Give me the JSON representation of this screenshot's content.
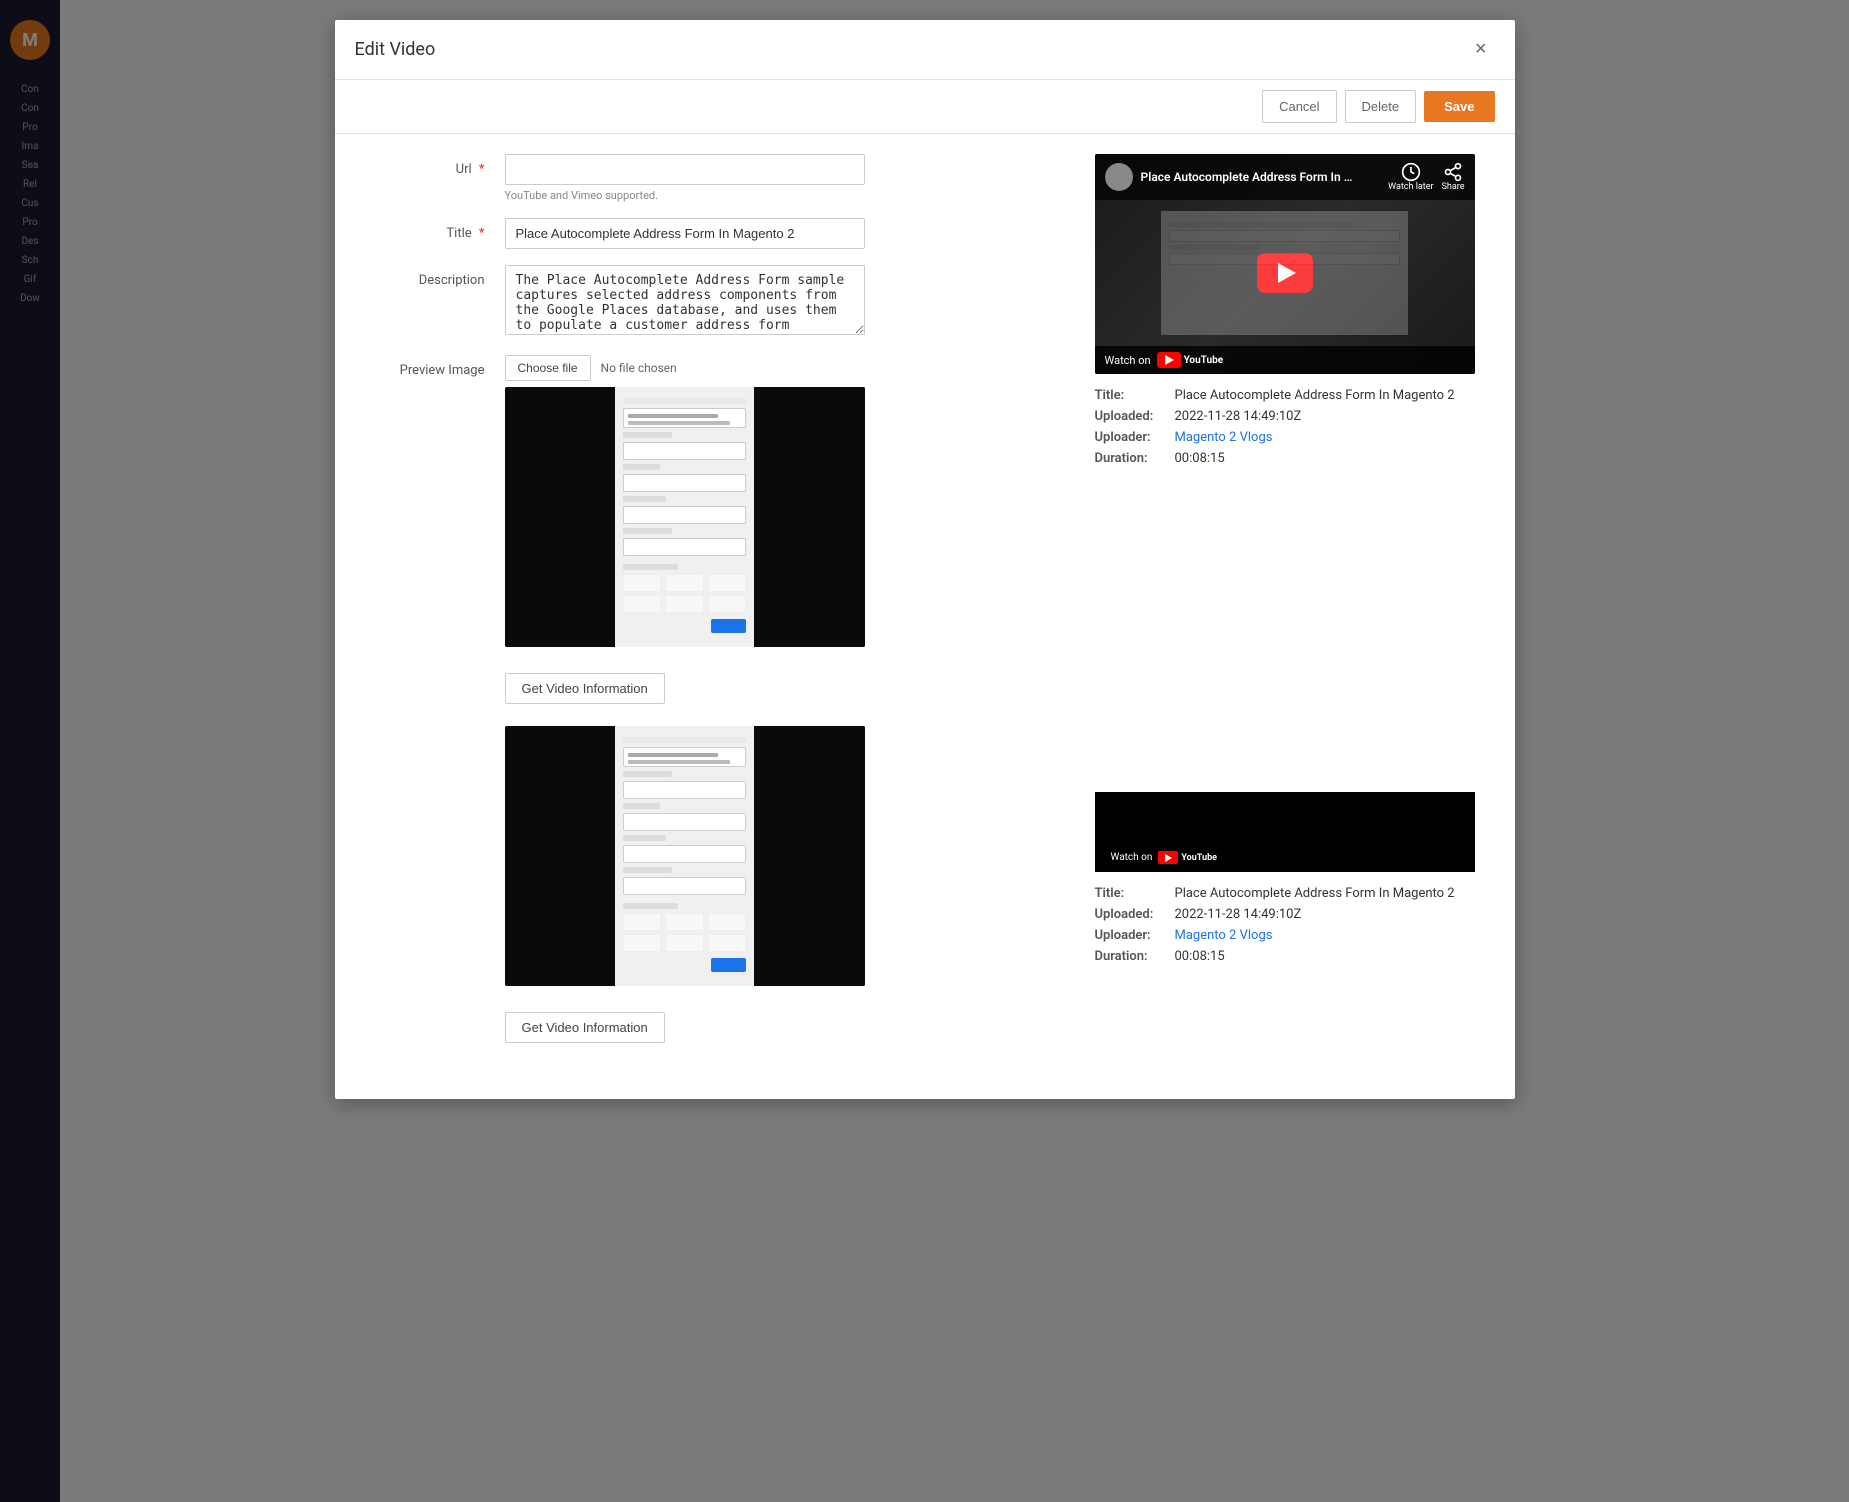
{
  "modal": {
    "title": "Edit Video",
    "close_label": "×"
  },
  "toolbar": {
    "cancel_label": "Cancel",
    "delete_label": "Delete",
    "save_label": "Save"
  },
  "form": {
    "url_label": "Url",
    "url_placeholder": "",
    "url_hint": "YouTube and Vimeo supported.",
    "title_label": "Title",
    "title_value": "Place Autocomplete Address Form In Magento 2",
    "description_label": "Description",
    "description_value": "The Place Autocomplete Address Form sample captures selected address components from the Google Places database, and uses them to populate a customer address form (billing address and shipping address).",
    "preview_image_label": "Preview Image",
    "choose_file_label": "Choose file",
    "no_file_label": "No file chosen"
  },
  "video_info_1": {
    "title_label": "Title:",
    "title_value": "Place Autocomplete Address Form In Magento 2",
    "uploaded_label": "Uploaded:",
    "uploaded_value": "2022-11-28 14:49:10Z",
    "uploader_label": "Uploader:",
    "uploader_value": "Magento 2 Vlogs",
    "duration_label": "Duration:",
    "duration_value": "00:08:15"
  },
  "video_info_2": {
    "title_label": "Title:",
    "title_value": "Place Autocomplete Address Form In Magento 2",
    "uploaded_label": "Uploaded:",
    "uploaded_value": "2022-11-28 14:49:10Z",
    "uploader_label": "Uploader:",
    "uploader_value": "Magento 2 Vlogs",
    "duration_label": "Duration:",
    "duration_value": "00:08:15"
  },
  "video_thumbnail_1": {
    "title": "Place Autocomplete Address Form In Ma...",
    "watch_later_label": "Watch later",
    "share_label": "Share",
    "watch_on_label": "Watch on",
    "yt_label": "YouTube"
  },
  "video_thumbnail_2": {
    "watch_on_label": "Watch on",
    "yt_label": "YouTube"
  },
  "get_info_button": {
    "label": "Get Video Information"
  },
  "sidebar": {
    "logo_text": "M",
    "items": [
      {
        "label": "Con"
      },
      {
        "label": "Con"
      },
      {
        "label": "Pro"
      },
      {
        "label": "Ima"
      },
      {
        "label": "Sea"
      },
      {
        "label": "Rel"
      },
      {
        "label": "Cus"
      },
      {
        "label": "Pro"
      },
      {
        "label": "Des"
      },
      {
        "label": "Sch"
      },
      {
        "label": "Gif"
      },
      {
        "label": "Dow"
      }
    ]
  },
  "colors": {
    "accent": "#e87722",
    "link": "#1a73e8",
    "required": "#e22626",
    "yt_red": "#ff0000"
  }
}
